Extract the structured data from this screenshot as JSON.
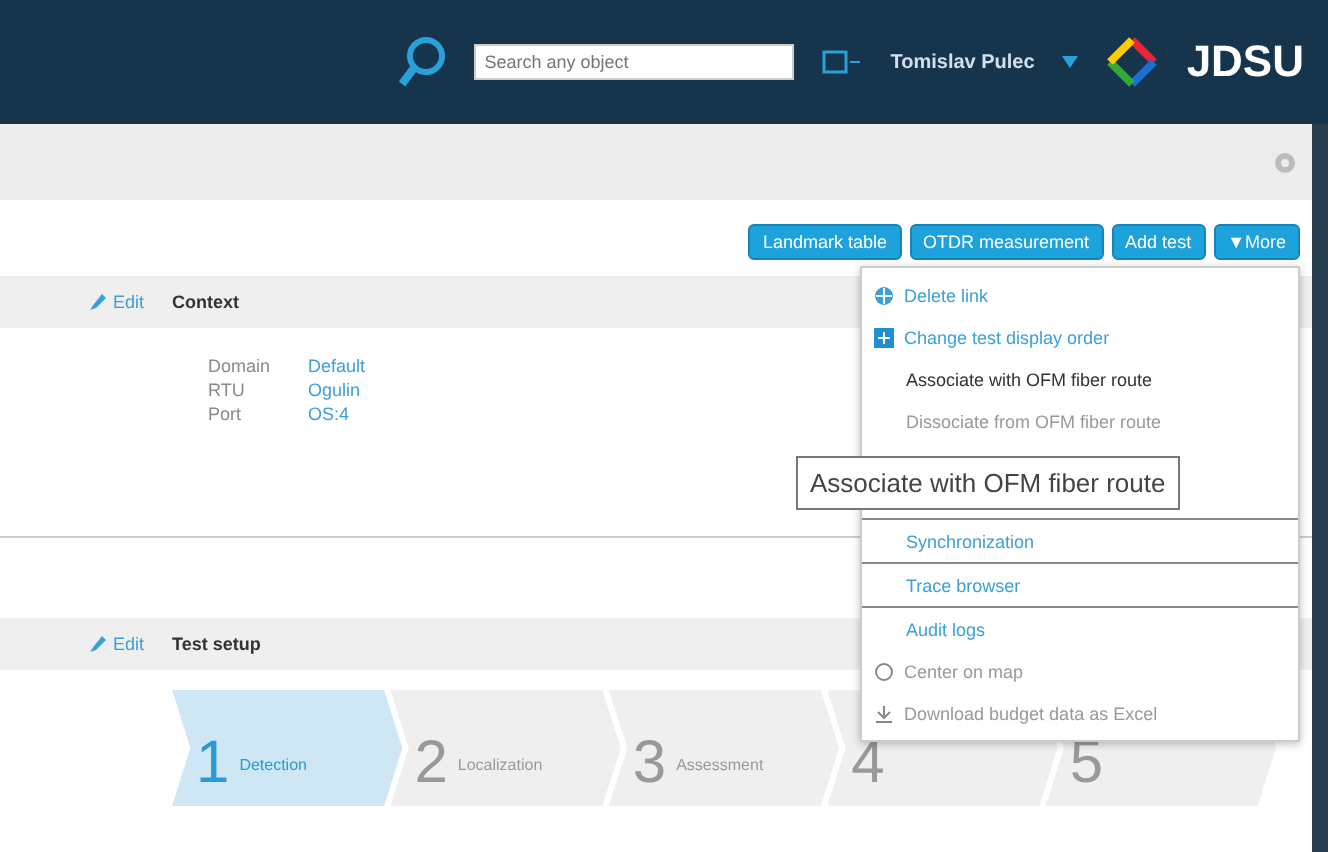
{
  "header": {
    "search": {
      "placeholder": "Search any object"
    },
    "user": "Tomislav Pulec",
    "logo": "JDSU"
  },
  "actions": [
    "Landmark table",
    "OTDR measurement",
    "Add test",
    "▼More"
  ],
  "context": {
    "edit": "Edit",
    "title": "Context",
    "fields": [
      {
        "label": "Domain",
        "value": "Default"
      },
      {
        "label": "RTU",
        "value": "Ogulin"
      },
      {
        "label": "Port",
        "value": "OS:4"
      }
    ]
  },
  "test_setup": {
    "edit": "Edit",
    "title": "Test setup",
    "steps": [
      {
        "number": "1",
        "label": "Detection",
        "selected": true
      },
      {
        "number": "2",
        "label": "Localization",
        "selected": false
      },
      {
        "number": "3",
        "label": "Assessment",
        "selected": false
      },
      {
        "number": "4",
        "selected": false
      },
      {
        "number": "5",
        "selected": false
      }
    ]
  },
  "menu": {
    "items": [
      {
        "kind": "icon",
        "label": "Delete link",
        "disabled": false
      },
      {
        "kind": "icon",
        "label": "Change test display order",
        "disabled": false
      },
      {
        "kind": "plain",
        "label": "Associate with OFM fiber route",
        "disabled": false
      },
      {
        "kind": "plain",
        "label": "Dissociate from OFM fiber route",
        "disabled": true
      },
      {
        "kind": "link",
        "label": "Synchronization",
        "disabled": false
      },
      {
        "kind": "link",
        "label": "Trace browser",
        "disabled": false
      },
      {
        "kind": "link",
        "label": "Audit logs",
        "disabled": false
      },
      {
        "kind": "icon",
        "label": "Center on map",
        "disabled": true
      },
      {
        "kind": "icon",
        "label": "Download budget data as Excel",
        "disabled": true
      }
    ]
  },
  "tooltip": "Associate with OFM fiber route"
}
